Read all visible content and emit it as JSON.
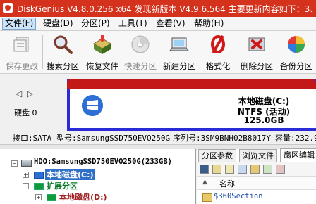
{
  "window": {
    "title": "DiskGenius V4.8.0.256 x64   发现新版本 V4.9.6.564 主要更新内容如下：3、"
  },
  "menu": [
    "文件(F)",
    "硬盘(D)",
    "分区(P)",
    "工具(T)",
    "查看(V)",
    "帮助(H)"
  ],
  "toolbar": [
    {
      "label": "保存更改",
      "icon": "save-icon",
      "enabled": false
    },
    {
      "label": "搜索分区",
      "icon": "search-partition-icon",
      "enabled": true
    },
    {
      "label": "恢复文件",
      "icon": "recover-files-icon",
      "enabled": true
    },
    {
      "label": "快速分区",
      "icon": "quick-partition-icon",
      "enabled": false
    },
    {
      "label": "新建分区",
      "icon": "new-partition-icon",
      "enabled": true
    },
    {
      "label": "格式化",
      "icon": "format-icon",
      "enabled": true
    },
    {
      "label": "删除分区",
      "icon": "delete-partition-icon",
      "enabled": true
    },
    {
      "label": "备份分区",
      "icon": "backup-partition-icon",
      "enabled": true
    }
  ],
  "disk": {
    "label": "硬盘 0",
    "volume_name": "本地磁盘(C:)",
    "volume_fs": "NTFS (活动)",
    "volume_size": "125.0GB"
  },
  "info": {
    "interface": "接口:SATA",
    "model": "型号:SamsungSSD750EVO250G",
    "serial": "序列号:3SM9BNH02B8017Y",
    "capacity": "容量:232.9"
  },
  "tree": {
    "disk": "HDO:SamsungSSD750EVO250G(233GB)",
    "partitions": [
      {
        "label": "本地磁盘(C:)",
        "selected": true
      },
      {
        "label": "扩展分区",
        "selected": false
      },
      {
        "label": "本地磁盘(D:)",
        "selected": false
      }
    ]
  },
  "right_tabs": [
    "分区参数",
    "浏览文件",
    "扇区编辑"
  ],
  "file_list": {
    "column_name": "名称",
    "rows": [
      "$360Section"
    ]
  }
}
